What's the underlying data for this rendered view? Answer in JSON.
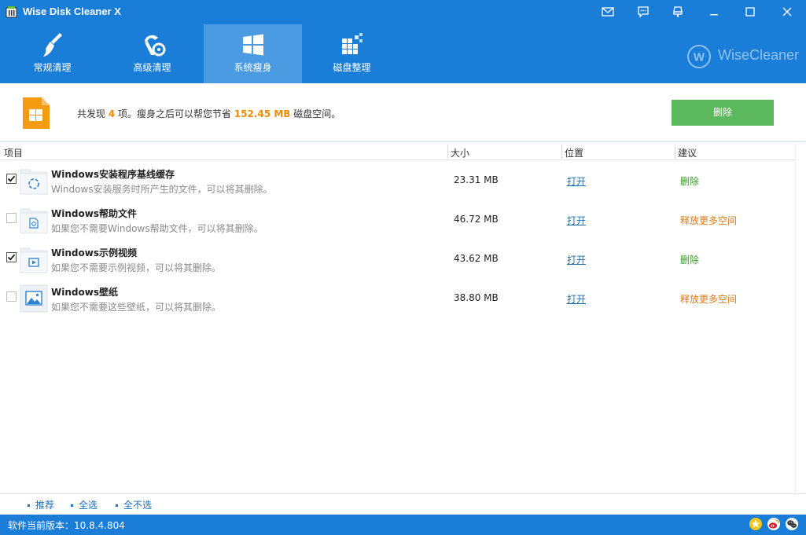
{
  "window": {
    "title": "Wise Disk Cleaner X"
  },
  "nav": {
    "tabs": [
      {
        "label": "常规清理",
        "icon": "broom-icon"
      },
      {
        "label": "高级清理",
        "icon": "vacuum-icon"
      },
      {
        "label": "系统瘦身",
        "icon": "windows-logo-icon",
        "active": true
      },
      {
        "label": "磁盘整理",
        "icon": "defrag-blocks-icon"
      }
    ],
    "brand": "WiseCleaner",
    "brand_mark": "W"
  },
  "summary": {
    "prefix": "共发现 ",
    "count": "4",
    "middle": " 项。瘦身之后可以帮您节省 ",
    "size": "152.45 MB",
    "suffix": " 磁盘空间。",
    "delete_label": "删除"
  },
  "table": {
    "headers": {
      "item": "项目",
      "size": "大小",
      "location": "位置",
      "suggestion": "建议"
    },
    "rows": [
      {
        "checked": true,
        "title": "Windows安装程序基线缓存",
        "desc": "Windows安装服务时所产生的文件，可以将其删除。",
        "size": "23.31 MB",
        "open": "打开",
        "suggestion": "删除",
        "suggestion_color": "green",
        "icon": "installer-cache-icon"
      },
      {
        "checked": false,
        "title": "Windows帮助文件",
        "desc": "如果您不需要Windows帮助文件，可以将其删除。",
        "size": "46.72 MB",
        "open": "打开",
        "suggestion": "释放更多空间",
        "suggestion_color": "orange",
        "icon": "help-file-icon"
      },
      {
        "checked": true,
        "title": "Windows示例视频",
        "desc": "如果您不需要示例视频，可以将其删除。",
        "size": "43.62 MB",
        "open": "打开",
        "suggestion": "删除",
        "suggestion_color": "green",
        "icon": "video-file-icon"
      },
      {
        "checked": false,
        "title": "Windows壁纸",
        "desc": "如果您不需要这些壁纸，可以将其删除。",
        "size": "38.80 MB",
        "open": "打开",
        "suggestion": "释放更多空间",
        "suggestion_color": "orange",
        "icon": "wallpaper-icon"
      }
    ]
  },
  "footer": {
    "links": [
      "推荐",
      "全选",
      "全不选"
    ]
  },
  "status": {
    "version": "软件当前版本：10.8.4.804"
  },
  "colors": {
    "primary": "#1a7ed8",
    "active_tab": "#4a9be2",
    "delete_button": "#5cb85c",
    "highlight": "#f08c00",
    "suggest_delete": "#3c9a2b",
    "suggest_free": "#e07b1a"
  }
}
